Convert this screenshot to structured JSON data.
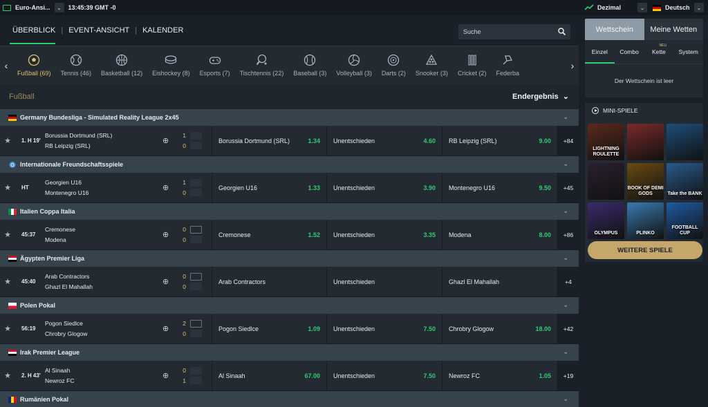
{
  "topbar": {
    "region": "Euro-Ansi...",
    "clock": "13:45:39 GMT -0",
    "odds_format": "Dezimal",
    "language": "Deutsch"
  },
  "nav": {
    "tabs": [
      "ÜBERBLICK",
      "EVENT-ANSICHT",
      "KALENDER"
    ],
    "search_placeholder": "Suche"
  },
  "sports": [
    {
      "label": "Fußball (69)",
      "icon": "soccer-ball-icon"
    },
    {
      "label": "Tennis (46)",
      "icon": "tennis-ball-icon"
    },
    {
      "label": "Basketball (12)",
      "icon": "basketball-icon"
    },
    {
      "label": "Eishockey (8)",
      "icon": "hockey-puck-icon"
    },
    {
      "label": "Esports (7)",
      "icon": "gamepad-icon"
    },
    {
      "label": "Tischtennis (22)",
      "icon": "table-tennis-icon"
    },
    {
      "label": "Baseball (3)",
      "icon": "baseball-icon"
    },
    {
      "label": "Volleyball (3)",
      "icon": "volleyball-icon"
    },
    {
      "label": "Darts (2)",
      "icon": "darts-icon"
    },
    {
      "label": "Snooker (3)",
      "icon": "snooker-icon"
    },
    {
      "label": "Cricket (2)",
      "icon": "cricket-icon"
    },
    {
      "label": "Federba",
      "icon": "badminton-icon"
    }
  ],
  "section": {
    "title": "Fußball",
    "market": "Endergebnis"
  },
  "leagues": [
    {
      "name": "Germany Bundesliga - Simulated Reality League 2x45",
      "flag": "de",
      "match": {
        "time": "1. H 19'",
        "home": "Borussia Dortmund (SRL)",
        "away": "RB Leipzig (SRL)",
        "score_home": "1",
        "score_away": "0",
        "has_field": false,
        "o1_name": "Borussia Dortmund (SRL)",
        "o1": "1.34",
        "ox_name": "Unentschieden",
        "ox": "4.60",
        "o2_name": "RB Leipzig (SRL)",
        "o2": "9.00",
        "more": "+84"
      }
    },
    {
      "name": "Internationale Freundschaftsspiele",
      "flag": "intl",
      "match": {
        "time": "HT",
        "home": "Georgien U16",
        "away": "Montenegro U16",
        "score_home": "1",
        "score_away": "0",
        "has_field": false,
        "o1_name": "Georgien U16",
        "o1": "1.33",
        "ox_name": "Unentschieden",
        "ox": "3.90",
        "o2_name": "Montenegro U16",
        "o2": "9.50",
        "more": "+45"
      }
    },
    {
      "name": "Italien Coppa Italia",
      "flag": "it",
      "match": {
        "time": "45:37",
        "home": "Cremonese",
        "away": "Modena",
        "score_home": "0",
        "score_away": "0",
        "has_field": true,
        "o1_name": "Cremonese",
        "o1": "1.52",
        "ox_name": "Unentschieden",
        "ox": "3.35",
        "o2_name": "Modena",
        "o2": "8.00",
        "more": "+86"
      }
    },
    {
      "name": "Ägypten Premier Liga",
      "flag": "eg",
      "match": {
        "time": "45:40",
        "home": "Arab Contractors",
        "away": "Ghazl El Mahallah",
        "score_home": "0",
        "score_away": "0",
        "has_field": true,
        "o1_name": "Arab Contractors",
        "o1": "",
        "ox_name": "Unentschieden",
        "ox": "",
        "o2_name": "Ghazl El Mahallah",
        "o2": "",
        "more": "+4"
      }
    },
    {
      "name": "Polen Pokal",
      "flag": "pl",
      "match": {
        "time": "56:19",
        "home": "Pogon Siedlce",
        "away": "Chrobry Glogow",
        "score_home": "2",
        "score_away": "0",
        "has_field": true,
        "o1_name": "Pogon Siedlce",
        "o1": "1.09",
        "ox_name": "Unentschieden",
        "ox": "7.50",
        "o2_name": "Chrobry Glogow",
        "o2": "18.00",
        "more": "+42"
      }
    },
    {
      "name": "Irak Premier League",
      "flag": "iq",
      "match": {
        "time": "2. H 43'",
        "home": "Al Sinaah",
        "away": "Newroz FC",
        "score_home": "0",
        "score_away": "1",
        "has_field": false,
        "o1_name": "Al Sinaah",
        "o1": "67.00",
        "ox_name": "Unentschieden",
        "ox": "7.50",
        "o2_name": "Newroz FC",
        "o2": "1.05",
        "more": "+19"
      }
    },
    {
      "name": "Rumänien Pokal",
      "flag": "ro",
      "match": null
    }
  ],
  "betslip": {
    "tabs": [
      "Wettschein",
      "Meine Wetten"
    ],
    "subtabs": [
      "Einzel",
      "Combo",
      "Kette",
      "System"
    ],
    "new_badge": "NEU",
    "empty_text": "Der Wettschein ist leer"
  },
  "mini_games": {
    "title": "MINI-SPIELE",
    "games": [
      {
        "label": "LIGHTNING ROULETTE",
        "color": "#5a2a1c"
      },
      {
        "label": "",
        "color": "#7a2a2a"
      },
      {
        "label": "",
        "color": "#1d4f7a"
      },
      {
        "label": "",
        "color": "#2a2030"
      },
      {
        "label": "BOOK OF DEMI GODS",
        "color": "#6a4a12"
      },
      {
        "label": "Take the BANK",
        "color": "#2a5a8a"
      },
      {
        "label": "OLYMPUS",
        "color": "#3a2a6a"
      },
      {
        "label": "PLINKO",
        "color": "#3a7ab0"
      },
      {
        "label": "FOOTBALL CUP",
        "color": "#1e5aa0"
      }
    ],
    "more_label": "WEITERE SPIELE"
  },
  "colors": {
    "accent_green": "#2ecc71",
    "gold": "#c6a76a",
    "league_bar": "#36434d"
  }
}
